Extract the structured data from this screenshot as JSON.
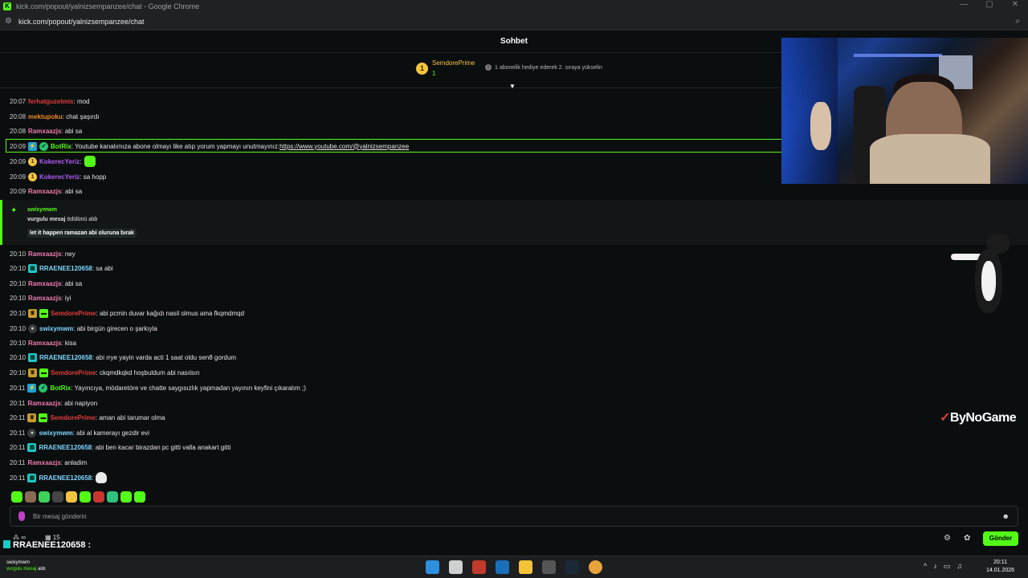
{
  "browser": {
    "window_title": "kick.com/popout/yalnizsempanzee/chat - Google Chrome",
    "url": "kick.com/popout/yalnizsempanzee/chat",
    "logo_letter": "K",
    "min": "—",
    "max": "▢",
    "close": "✕"
  },
  "chat": {
    "header": "Sohbet",
    "pinned": {
      "rank": "1",
      "user": "SemdorePrime",
      "count": "1",
      "tip": "1 abonelik hediye ederek 2. sıraya yükselin"
    },
    "messages_top": [
      {
        "time": "20:07",
        "user": "ferhatguzelmis",
        "text": ": mod"
      },
      {
        "time": "20:08",
        "user": "mektupoku",
        "text": ": chat şaşırdı"
      },
      {
        "time": "20:08",
        "user": "Ramxaazjs",
        "text": ": abi sa"
      },
      {
        "time": "20:09",
        "user": "BotRix",
        "text": ": Youtube kanalımıza abone olmayı like atıp yorum yapmayı unutmayınız: ",
        "link": "https://www.youtube.com/@yalnizsempanzee"
      },
      {
        "time": "20:09",
        "user": "KokerecYeriz",
        "text": ":"
      },
      {
        "time": "20:09",
        "user": "KokerecYeriz",
        "text": ": sa hopp"
      },
      {
        "time": "20:09",
        "user": "Ramxaazjs",
        "text": ": abi sa"
      }
    ],
    "reward": {
      "user": "swixymwm",
      "bold": "vurgulu mesaj",
      "text": " ödülünü aldı",
      "message": "let it happen ramazan abi oluruna bırak"
    },
    "messages_bottom": [
      {
        "time": "20:10",
        "user": "Ramxaazjs",
        "text": ": ney"
      },
      {
        "time": "20:10",
        "user": "RRAENEE120658",
        "text": ": sa abi"
      },
      {
        "time": "20:10",
        "user": "Ramxaazjs",
        "text": ": abi sa"
      },
      {
        "time": "20:10",
        "user": "Ramxaazjs",
        "text": ": iyi"
      },
      {
        "time": "20:10",
        "user": "SemdorePrime",
        "text": ": abi pcmin duvar kağıdı nasil olmus ama fkqmdmqd"
      },
      {
        "time": "20:10",
        "user": "swixymwm",
        "text": ": abi birgün girecen o şarkıyla"
      },
      {
        "time": "20:10",
        "user": "Ramxaazjs",
        "text": ": kisa"
      },
      {
        "time": "20:10",
        "user": "RRAENEE120658",
        "text": ": abi rrye yayin varda acti 1 saat oldu sen8 gordum"
      },
      {
        "time": "20:10",
        "user": "SemdorePrime",
        "text": ": ckqmdkqkd hoşbuldum abi nasılsın"
      },
      {
        "time": "20:11",
        "user": "BotRix",
        "text": ": Yayıncıya, mödaretöre ve chatte saygısızlık yapmadan yayının keyfini çıkaralım ;)"
      },
      {
        "time": "20:11",
        "user": "Ramxaazjs",
        "text": ": abi napiyon"
      },
      {
        "time": "20:11",
        "user": "SemdorePrime",
        "text": ": aman abi tarumar olma"
      },
      {
        "time": "20:11",
        "user": "swixymwm",
        "text": ": abi al kamerayı gezdir evi"
      },
      {
        "time": "20:11",
        "user": "RRAENEE120658",
        "text": ": abi ben kacar birazdan pc gitti valla anakart gitti"
      },
      {
        "time": "20:11",
        "user": "Ramxaazjs",
        "text": ": anladim"
      },
      {
        "time": "20:11",
        "user": "RRAENEE120658",
        "text": ":"
      }
    ],
    "input_placeholder": "Bir mesaj gönderin",
    "send_label": "Gönder",
    "stats": {
      "points": "∞",
      "count": "15"
    },
    "overlay_user": "RRAENEE120658 :"
  },
  "stream": {
    "brand": "ByNoGame"
  },
  "taskbar": {
    "user": "swixymwm",
    "user_sub": "vurgulu mesaj",
    "user_sub2": "aldı",
    "time": "20:11",
    "date": "14.01.2026"
  },
  "colors": {
    "kick_green": "#53fc18",
    "gold": "#f5c542",
    "semdore_red": "#e23b3b",
    "ramx_pink": "#f07db1",
    "purple": "#b05cf5",
    "orange": "#f08a24",
    "cyan": "#7fd6ff"
  }
}
